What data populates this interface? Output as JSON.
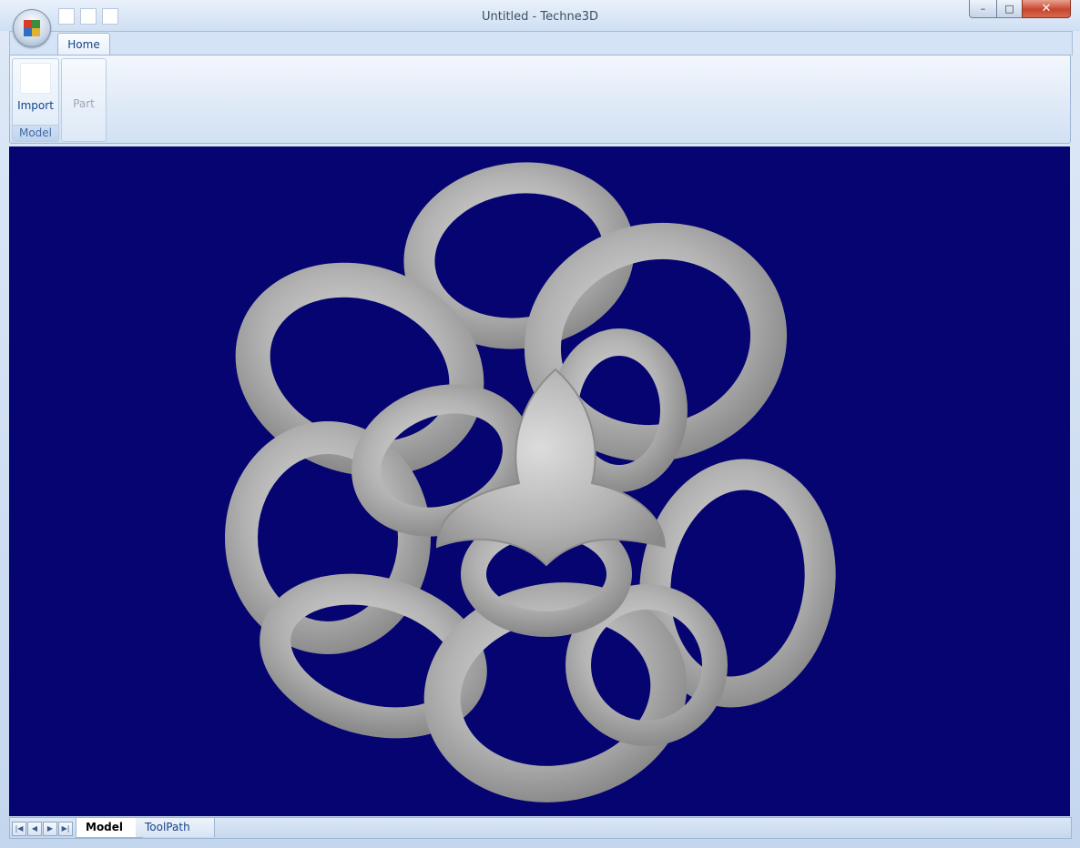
{
  "window": {
    "title": "Untitled - Techne3D"
  },
  "quick_access": {
    "buttons": [
      "",
      "",
      ""
    ]
  },
  "window_controls": {
    "minimize": "–",
    "maximize": "□",
    "close": "✕"
  },
  "ribbon": {
    "tabs": [
      {
        "label": "Home",
        "active": true
      }
    ],
    "groups": [
      {
        "name": "Model",
        "buttons": [
          {
            "label": "Import",
            "enabled": true
          }
        ]
      },
      {
        "name": "",
        "buttons": [
          {
            "label": "Part",
            "enabled": false
          }
        ]
      }
    ]
  },
  "viewport": {
    "background": "#050470",
    "model_color": "#b8b8b8"
  },
  "sheet_navigator": {
    "buttons": [
      "first",
      "previous",
      "next",
      "last"
    ]
  },
  "sheet_tabs": [
    {
      "label": "Model",
      "active": true
    },
    {
      "label": "ToolPath",
      "active": false
    }
  ]
}
